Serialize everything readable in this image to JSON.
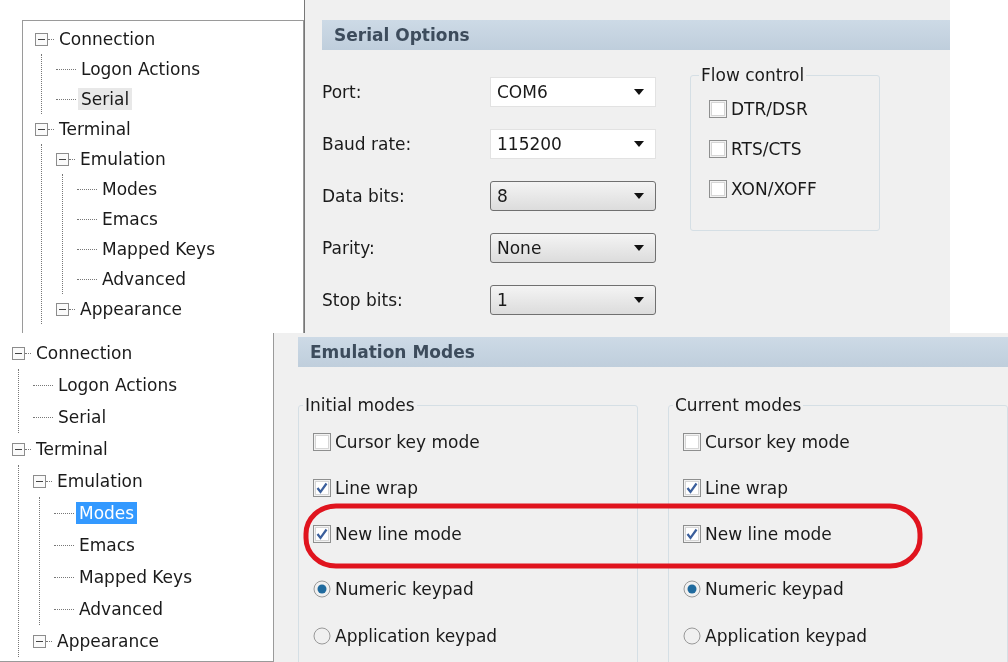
{
  "panels": [
    {
      "kind": "serial",
      "tree": {
        "focused": false,
        "items": [
          {
            "label": "Connection",
            "expanded": true,
            "selected": false,
            "children": [
              {
                "label": "Logon Actions",
                "selected": false
              },
              {
                "label": "Serial",
                "selected": true
              }
            ]
          },
          {
            "label": "Terminal",
            "expanded": true,
            "selected": false,
            "children": [
              {
                "label": "Emulation",
                "expanded": true,
                "selected": false,
                "children": [
                  {
                    "label": "Modes",
                    "selected": false
                  },
                  {
                    "label": "Emacs",
                    "selected": false
                  },
                  {
                    "label": "Mapped Keys",
                    "selected": false
                  },
                  {
                    "label": "Advanced",
                    "selected": false
                  }
                ]
              },
              {
                "label": "Appearance",
                "expanded": true,
                "selected": false
              }
            ]
          }
        ]
      },
      "header": "Serial Options",
      "fields": [
        {
          "label": "Port:",
          "value": "COM6",
          "kind": "editable"
        },
        {
          "label": "Baud rate:",
          "value": "115200",
          "kind": "editable"
        },
        {
          "label": "Data bits:",
          "value": "8",
          "kind": "dropdown"
        },
        {
          "label": "Parity:",
          "value": "None",
          "kind": "dropdown"
        },
        {
          "label": "Stop bits:",
          "value": "1",
          "kind": "dropdown"
        }
      ],
      "flow_control": {
        "title": "Flow control",
        "options": [
          {
            "label": "DTR/DSR",
            "checked": false
          },
          {
            "label": "RTS/CTS",
            "checked": false
          },
          {
            "label": "XON/XOFF",
            "checked": false
          }
        ]
      }
    },
    {
      "kind": "modes",
      "tree": {
        "focused": true,
        "items": [
          {
            "label": "Connection",
            "expanded": true,
            "selected": false,
            "children": [
              {
                "label": "Logon Actions",
                "selected": false
              },
              {
                "label": "Serial",
                "selected": false
              }
            ]
          },
          {
            "label": "Terminal",
            "expanded": true,
            "selected": false,
            "children": [
              {
                "label": "Emulation",
                "expanded": true,
                "selected": false,
                "children": [
                  {
                    "label": "Modes",
                    "selected": true
                  },
                  {
                    "label": "Emacs",
                    "selected": false
                  },
                  {
                    "label": "Mapped Keys",
                    "selected": false
                  },
                  {
                    "label": "Advanced",
                    "selected": false
                  }
                ]
              },
              {
                "label": "Appearance",
                "expanded": true,
                "selected": false
              }
            ]
          }
        ]
      },
      "header": "Emulation Modes",
      "groups": [
        {
          "title": "Initial modes",
          "options": [
            {
              "label": "Cursor key mode",
              "kind": "checkbox",
              "checked": false
            },
            {
              "label": "Line wrap",
              "kind": "checkbox",
              "checked": true
            },
            {
              "label": "New line mode",
              "kind": "checkbox",
              "checked": true
            },
            {
              "label": "Numeric keypad",
              "kind": "radio",
              "selected": true
            },
            {
              "label": "Application keypad",
              "kind": "radio",
              "selected": false
            }
          ]
        },
        {
          "title": "Current modes",
          "options": [
            {
              "label": "Cursor key mode",
              "kind": "checkbox",
              "checked": false
            },
            {
              "label": "Line wrap",
              "kind": "checkbox",
              "checked": true
            },
            {
              "label": "New line mode",
              "kind": "checkbox",
              "checked": true
            },
            {
              "label": "Numeric keypad",
              "kind": "radio",
              "selected": true
            },
            {
              "label": "Application keypad",
              "kind": "radio",
              "selected": false
            }
          ]
        }
      ]
    }
  ]
}
